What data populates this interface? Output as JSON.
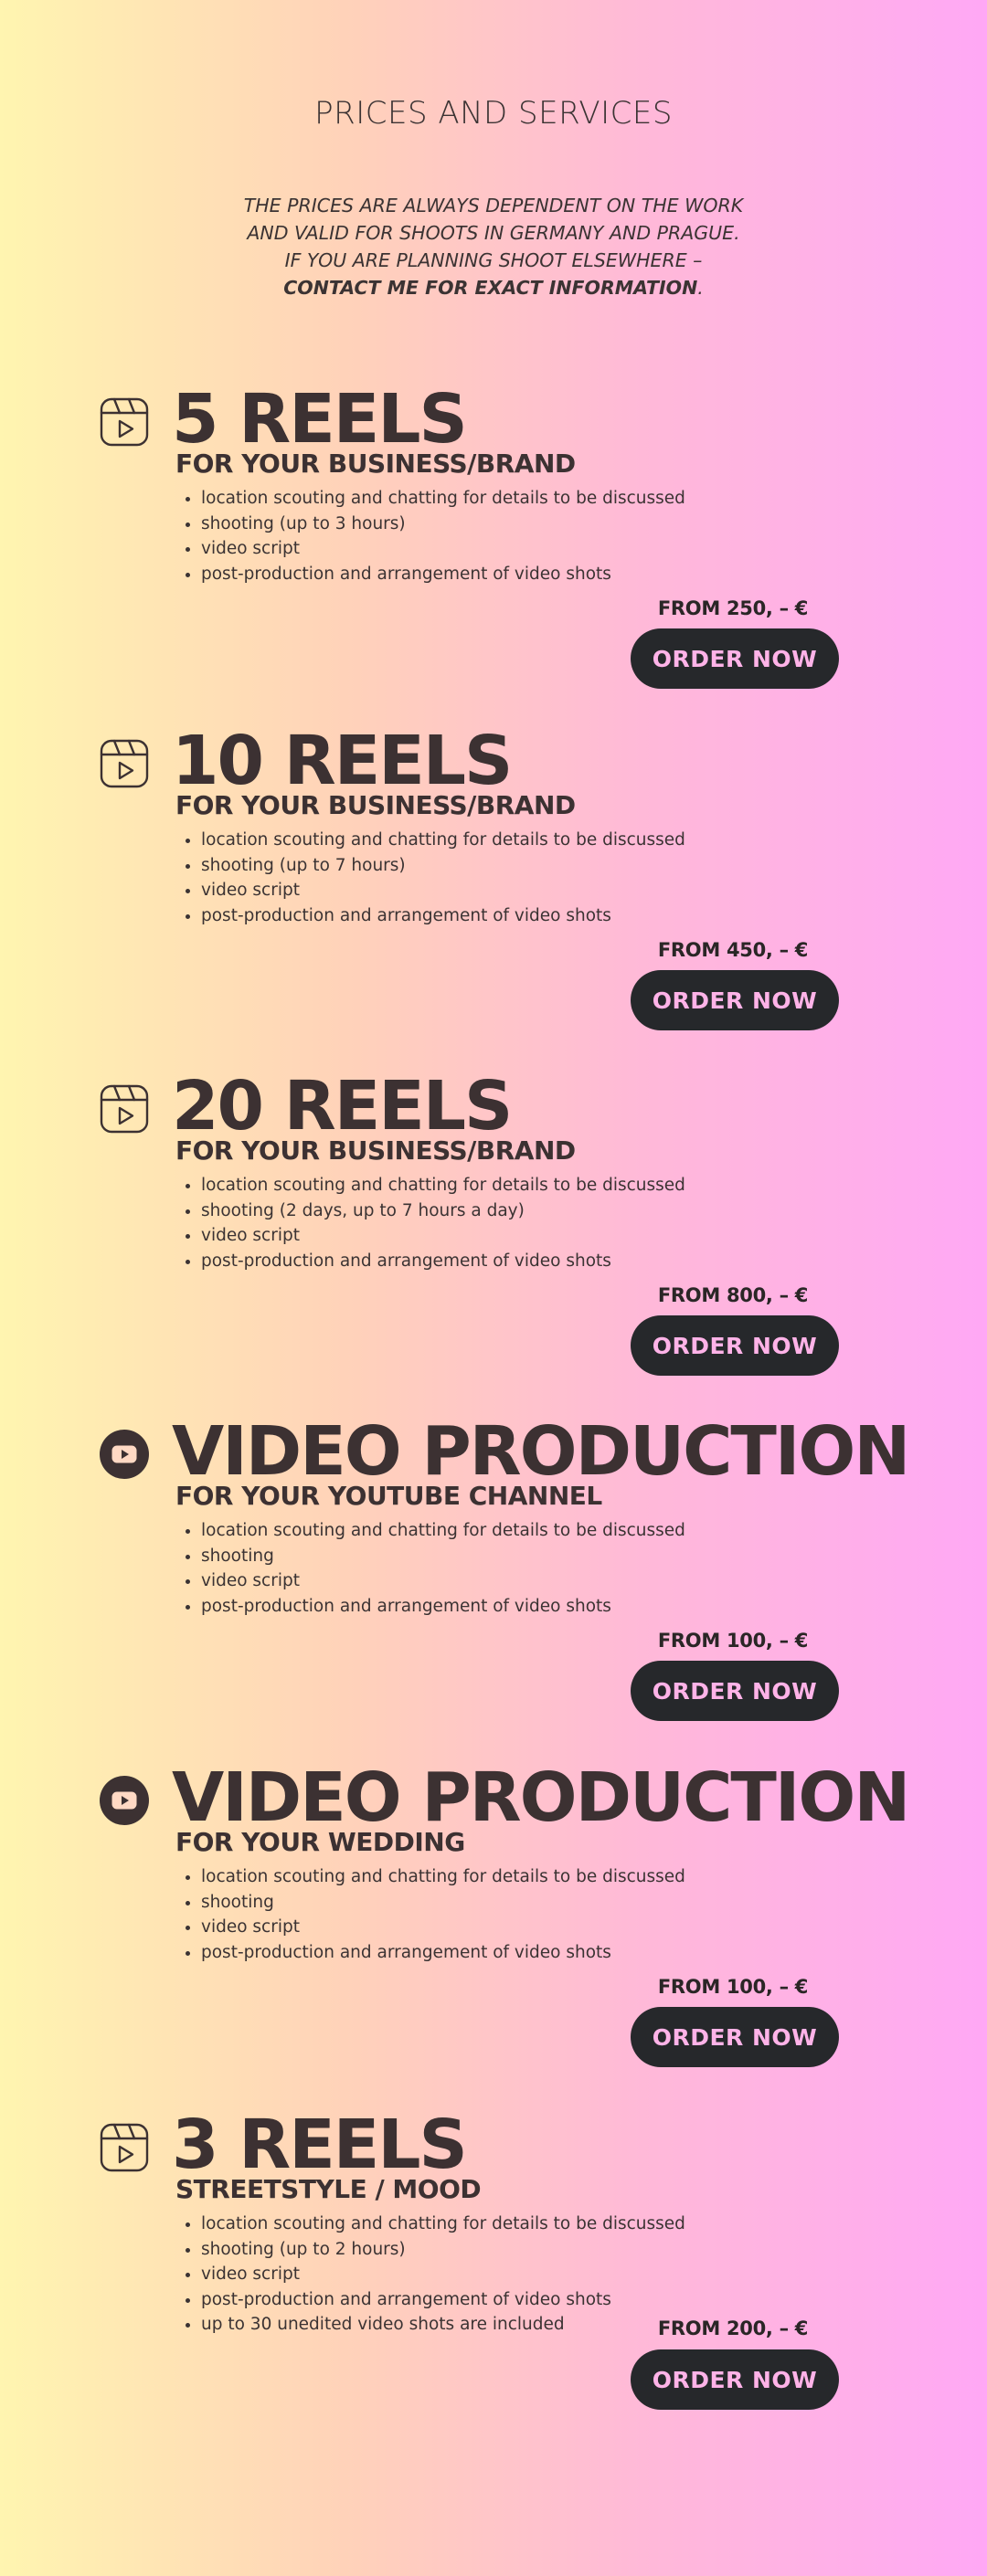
{
  "page": {
    "title": "PRICES AND SERVICES",
    "intro": {
      "line1": "THE PRICES ARE ALWAYS DEPENDENT ON THE WORK",
      "line2": "AND VALID FOR SHOOTS IN GERMANY AND PRAGUE.",
      "line3": "IF YOU ARE PLANNING SHOOT ELSEWHERE –",
      "line4_bold": "CONTACT ME FOR EXACT INFORMATION",
      "line4_end": "."
    }
  },
  "colors": {
    "gradient": [
      "#fff5b0",
      "#ffd2b9",
      "#ffb9d8",
      "#ffa8f5"
    ],
    "button_bg": "#26282b",
    "button_text": "#ffb3e8",
    "text_dark": "#3c3132"
  },
  "services": [
    {
      "icon": "reels-clapper-icon",
      "title": "5 REELS",
      "subtitle": "FOR YOUR BUSINESS/BRAND",
      "items": [
        "location scouting and chatting for details to be discussed",
        "shooting (up to 3 hours)",
        "video script",
        "post-production and arrangement of video shots"
      ],
      "price": "FROM 250, – €",
      "button": "ORDER NOW"
    },
    {
      "icon": "reels-clapper-icon",
      "title": "10 REELS",
      "subtitle": "FOR YOUR BUSINESS/BRAND",
      "items": [
        "location scouting and chatting for details to be discussed",
        "shooting (up to 7 hours)",
        "video script",
        "post-production and arrangement of video shots"
      ],
      "price": "FROM 450, – €",
      "button": "ORDER NOW"
    },
    {
      "icon": "reels-clapper-icon",
      "title": "20 REELS",
      "subtitle": "FOR YOUR BUSINESS/BRAND",
      "items": [
        "location scouting and chatting for details to be discussed",
        "shooting (2 days, up to 7 hours a day)",
        "video script",
        "post-production and arrangement of video shots"
      ],
      "price": "FROM 800, – €",
      "button": "ORDER NOW"
    },
    {
      "icon": "youtube-icon",
      "title": "VIDEO PRODUCTION",
      "subtitle": "FOR YOUR YOUTUBE CHANNEL",
      "items": [
        "location scouting and chatting for details to be discussed",
        "shooting",
        "video script",
        "post-production and arrangement of video shots"
      ],
      "price": "FROM 100, – €",
      "button": "ORDER NOW"
    },
    {
      "icon": "youtube-icon",
      "title": "VIDEO PRODUCTION",
      "subtitle": "FOR YOUR WEDDING",
      "items": [
        "location scouting and chatting for details to be discussed",
        "shooting",
        "video script",
        "post-production and arrangement of video shots"
      ],
      "price": "FROM 100, – €",
      "button": "ORDER NOW"
    },
    {
      "icon": "reels-clapper-icon",
      "title": "3 REELS",
      "subtitle": "STREETSTYLE / MOOD",
      "items": [
        "location scouting and chatting for details to be discussed",
        "shooting (up to 2 hours)",
        "video script",
        "post-production and arrangement of video shots",
        "up to 30 unedited video shots are included"
      ],
      "price": "FROM 200, – €",
      "button": "ORDER NOW"
    }
  ]
}
